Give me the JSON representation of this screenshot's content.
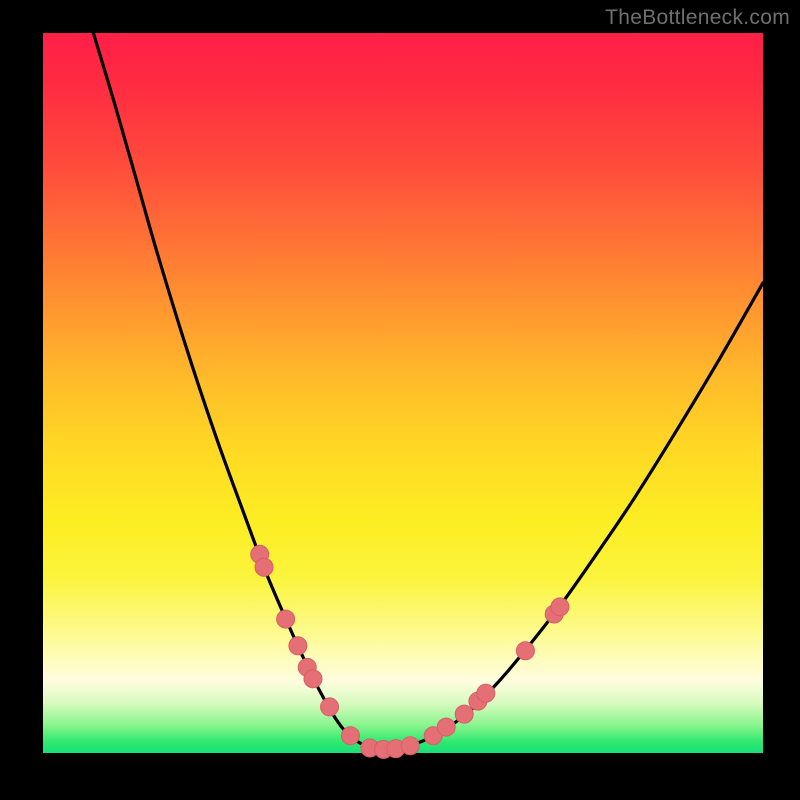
{
  "watermark": "TheBottleneck.com",
  "colors": {
    "curve_stroke": "#000000",
    "marker_fill": "#e46f74",
    "marker_stroke": "#d85e66"
  },
  "chart_data": {
    "type": "line",
    "title": "",
    "xlabel": "",
    "ylabel": "",
    "xlim": [
      0,
      100
    ],
    "ylim": [
      0,
      100
    ],
    "series": [
      {
        "name": "bottleneck-curve",
        "x": [
          7,
          10,
          13,
          16,
          20,
          24,
          28,
          31,
          34,
          36.5,
          38.5,
          40.5,
          42,
          44,
          46,
          48.5,
          51.5,
          55,
          59,
          63,
          67,
          72,
          77,
          82,
          88,
          94,
          100
        ],
        "y": [
          100,
          90,
          79.5,
          69,
          56,
          44,
          33,
          25,
          18,
          12.5,
          8.5,
          5,
          3,
          1.4,
          0.6,
          0.6,
          1.2,
          2.8,
          5.6,
          9.6,
          14.3,
          20.7,
          27.8,
          35.2,
          44.8,
          54.8,
          65.3
        ]
      }
    ],
    "markers": [
      {
        "x": 30.1,
        "y": 27.6
      },
      {
        "x": 30.7,
        "y": 25.8
      },
      {
        "x": 33.7,
        "y": 18.6
      },
      {
        "x": 35.4,
        "y": 14.9
      },
      {
        "x": 36.7,
        "y": 11.9
      },
      {
        "x": 37.5,
        "y": 10.3
      },
      {
        "x": 39.8,
        "y": 6.4
      },
      {
        "x": 42.7,
        "y": 2.4
      },
      {
        "x": 45.4,
        "y": 0.7
      },
      {
        "x": 47.3,
        "y": 0.5
      },
      {
        "x": 49.0,
        "y": 0.6
      },
      {
        "x": 51.0,
        "y": 1.0
      },
      {
        "x": 54.2,
        "y": 2.4
      },
      {
        "x": 56.0,
        "y": 3.6
      },
      {
        "x": 58.5,
        "y": 5.4
      },
      {
        "x": 60.4,
        "y": 7.2
      },
      {
        "x": 61.5,
        "y": 8.3
      },
      {
        "x": 67.0,
        "y": 14.2
      },
      {
        "x": 71.0,
        "y": 19.3
      },
      {
        "x": 71.8,
        "y": 20.3
      }
    ],
    "marker_radius_px": 9
  }
}
